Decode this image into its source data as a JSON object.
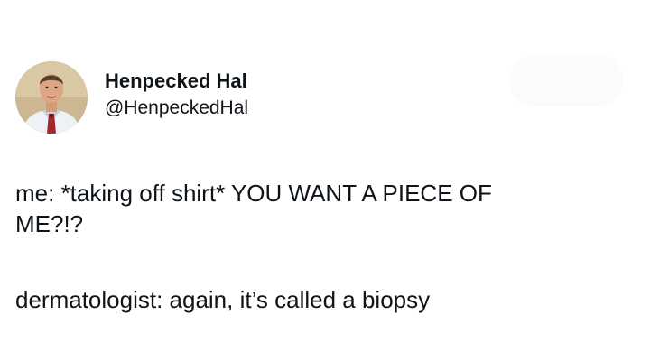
{
  "author": {
    "display_name": "Henpecked Hal",
    "handle": "@HenpeckedHal"
  },
  "tweet": {
    "line1": "me: *taking off shirt* YOU WANT A PIECE OF",
    "line2": "ME?!?",
    "line3": "dermatologist: again, it’s called a biopsy"
  },
  "icons": {
    "avatar": "profile-photo-man-in-shirt-and-tie"
  }
}
